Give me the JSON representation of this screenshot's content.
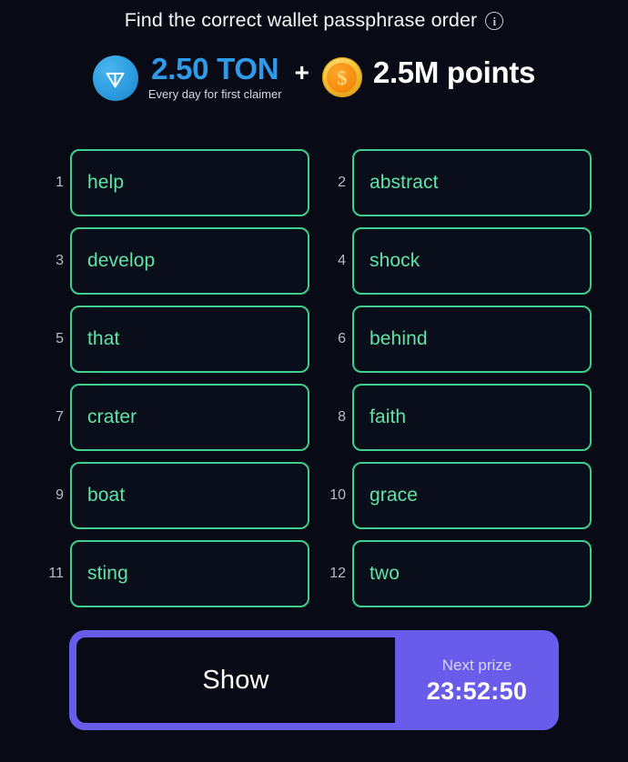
{
  "header": {
    "title": "Find the correct wallet passphrase order",
    "info_icon": "info-circle-icon"
  },
  "prize": {
    "ton_icon": "ton-logo-icon",
    "ton_amount": "2.50 TON",
    "ton_subtitle": "Every day for first claimer",
    "plus": "+",
    "coin_icon": "gold-coin-icon",
    "coin_symbol": "$",
    "points_amount": "2.5M points",
    "ton_color": "#2f9ae8",
    "points_color": "#ffffff"
  },
  "passphrase": {
    "accent_color": "#3ecf8e",
    "text_color": "#5fe3a6",
    "words": [
      {
        "index": "1",
        "word": "help"
      },
      {
        "index": "2",
        "word": "abstract"
      },
      {
        "index": "3",
        "word": "develop"
      },
      {
        "index": "4",
        "word": "shock"
      },
      {
        "index": "5",
        "word": "that"
      },
      {
        "index": "6",
        "word": "behind"
      },
      {
        "index": "7",
        "word": "crater"
      },
      {
        "index": "8",
        "word": "faith"
      },
      {
        "index": "9",
        "word": "boat"
      },
      {
        "index": "10",
        "word": "grace"
      },
      {
        "index": "11",
        "word": "sting"
      },
      {
        "index": "12",
        "word": "two"
      }
    ]
  },
  "action_bar": {
    "show_label": "Show",
    "next_prize_label": "Next prize",
    "timer": "23:52:50",
    "accent_color": "#6a5ceb"
  }
}
